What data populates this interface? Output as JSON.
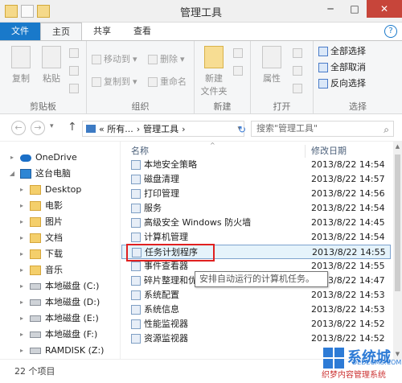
{
  "window": {
    "title": "管理工具"
  },
  "window_buttons": {
    "minimize": "─",
    "maximize": "□",
    "close": "✕"
  },
  "tabs": [
    "文件",
    "主页",
    "共享",
    "查看"
  ],
  "ribbon": {
    "clipboard": {
      "copy": "复制",
      "paste": "粘贴",
      "group": "剪贴板"
    },
    "organize": {
      "move_to": "移动到",
      "copy_to": "复制到",
      "delete": "删除",
      "rename": "重命名",
      "group": "组织"
    },
    "new": {
      "new_folder_line1": "新建",
      "new_folder_line2": "文件夹",
      "group": "新建"
    },
    "open": {
      "properties": "属性",
      "group": "打开"
    },
    "select": {
      "select_all": "全部选择",
      "select_none": "全部取消",
      "invert": "反向选择",
      "group": "选择"
    }
  },
  "nav_buttons": {
    "back": "←",
    "forward": "→",
    "recent": "▾",
    "up": "↑"
  },
  "address": {
    "crumbs": [
      "« 所有...",
      "›",
      "管理工具",
      "›"
    ],
    "dropdown": "▾",
    "refresh": "↻"
  },
  "search": {
    "placeholder": "搜索\"管理工具\"",
    "icon": "⌕"
  },
  "sidebar": {
    "items": [
      {
        "label": "OneDrive",
        "icon": "cloud-icon"
      },
      {
        "label": "这台电脑",
        "icon": "computer-icon"
      },
      {
        "label": "Desktop",
        "icon": "folder-icon"
      },
      {
        "label": "电影",
        "icon": "folder-icon"
      },
      {
        "label": "图片",
        "icon": "folder-icon"
      },
      {
        "label": "文档",
        "icon": "folder-icon"
      },
      {
        "label": "下载",
        "icon": "folder-icon"
      },
      {
        "label": "音乐",
        "icon": "folder-icon"
      },
      {
        "label": "本地磁盘 (C:)",
        "icon": "drive-icon"
      },
      {
        "label": "本地磁盘 (D:)",
        "icon": "drive-icon"
      },
      {
        "label": "本地磁盘 (E:)",
        "icon": "drive-icon"
      },
      {
        "label": "本地磁盘 (F:)",
        "icon": "drive-icon"
      },
      {
        "label": "RAMDISK (Z:)",
        "icon": "drive-icon"
      }
    ]
  },
  "columns": {
    "name": "名称",
    "date": "修改日期",
    "sort_indicator": "^"
  },
  "files": [
    {
      "name": "本地安全策略",
      "date": "2013/8/22 14:54"
    },
    {
      "name": "磁盘清理",
      "date": "2013/8/22 14:57"
    },
    {
      "name": "打印管理",
      "date": "2013/8/22 14:56"
    },
    {
      "name": "服务",
      "date": "2013/8/22 14:54"
    },
    {
      "name": "高级安全 Windows 防火墙",
      "date": "2013/8/22 14:45"
    },
    {
      "name": "计算机管理",
      "date": "2013/8/22 14:54"
    },
    {
      "name": "任务计划程序",
      "date": "2013/8/22 14:55"
    },
    {
      "name": "事件查看器",
      "date": "2013/8/22 14:55"
    },
    {
      "name": "碎片整理和优",
      "date": "2013/8/22 14:47"
    },
    {
      "name": "系统配置",
      "date": "2013/8/22 14:53"
    },
    {
      "name": "系统信息",
      "date": "2013/8/22 14:53"
    },
    {
      "name": "性能监视器",
      "date": "2013/8/22 14:52"
    },
    {
      "name": "资源监视器",
      "date": "2013/8/22 14:52"
    }
  ],
  "tooltip": "安排自动运行的计算机任务。",
  "status": {
    "count": "22 个项目"
  },
  "watermark": {
    "brand": "系统城",
    "url": "DEDECMS.COM",
    "site": "织梦内容管理系统"
  }
}
